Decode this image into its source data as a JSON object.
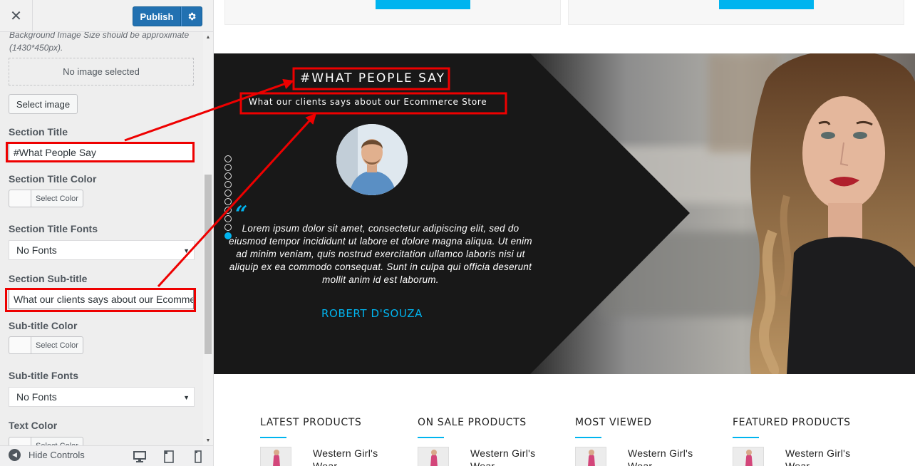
{
  "colors": {
    "accent": "#00b4ef",
    "publish": "#2271b1",
    "highlight": "#ee0000",
    "dark_panel": "#181818"
  },
  "sidebar": {
    "close_icon": "close-icon",
    "publish_label": "Publish",
    "settings_icon": "gear-icon",
    "background_note": "Background Image Size should be approximate (1430*450px).",
    "no_image_label": "No image selected",
    "select_image_label": "Select image",
    "section_title_label": "Section Title",
    "section_title_value": "#What People Say",
    "section_title_color_label": "Section Title Color",
    "select_color_label": "Select Color",
    "section_title_fonts_label": "Section Title Fonts",
    "section_title_fonts_value": "No Fonts",
    "section_subtitle_label": "Section Sub-title",
    "section_subtitle_value": "What our clients says about our Ecommerce Store",
    "subtitle_color_label": "Sub-title Color",
    "subtitle_fonts_label": "Sub-title Fonts",
    "subtitle_fonts_value": "No Fonts",
    "text_color_label": "Text Color",
    "hide_controls_label": "Hide Controls",
    "device_icons": [
      "desktop-icon",
      "tablet-icon",
      "mobile-icon"
    ]
  },
  "testimonial": {
    "title": "#WHAT PEOPLE SAY",
    "subtitle": "What our clients says about our Ecommerce Store",
    "quote_mark": "“",
    "quote": "Lorem ipsum dolor sit amet, consectetur adipiscing elit, sed do eiusmod tempor incididunt ut labore et dolore magna aliqua. Ut enim ad minim veniam, quis nostrud exercitation ullamco laboris nisi ut aliquip ex ea commodo consequat. Sunt in culpa qui officia deserunt mollit anim id est laborum.",
    "author": "ROBERT D'SOUZA",
    "slide_count": 10,
    "active_slide": 10
  },
  "products": {
    "columns": [
      {
        "heading": "LATEST PRODUCTS",
        "item_name": "Western Girl's Wear"
      },
      {
        "heading": "ON SALE PRODUCTS",
        "item_name": "Western Girl's Wear"
      },
      {
        "heading": "MOST VIEWED",
        "item_name": "Western Girl's Wear"
      },
      {
        "heading": "FEATURED PRODUCTS",
        "item_name": "Western Girl's Wear"
      }
    ]
  }
}
